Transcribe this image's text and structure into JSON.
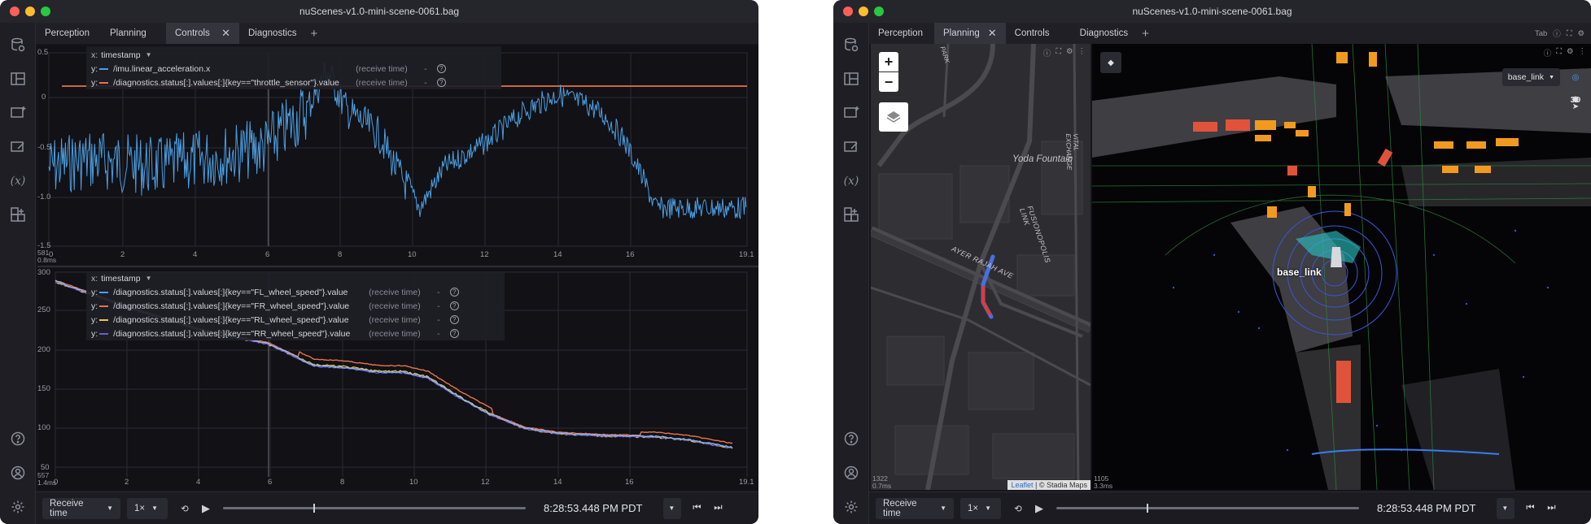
{
  "left_window": {
    "title": "nuScenes-v1.0-mini-scene-0061.bag",
    "tabs": [
      {
        "label": "Perception",
        "active": false
      },
      {
        "label": "Planning",
        "active": false
      },
      {
        "label": "Controls",
        "active": true
      },
      {
        "label": "Diagnostics",
        "active": false
      }
    ],
    "top_plot": {
      "x_axis_label": "timestamp",
      "series": [
        {
          "prefix": "y:",
          "path": "/imu.linear_acceleration.x",
          "timing": "(receive time)",
          "dash": "-",
          "color": "#4c9ee0"
        },
        {
          "prefix": "y:",
          "path": "/diagnostics.status[:].values[:]{key==\"throttle_sensor\"}.value",
          "timing": "(receive time)",
          "dash": "-",
          "color": "#e8734a"
        }
      ],
      "y_ticks": [
        "0.5",
        "0",
        "-0.5",
        "-1.0",
        "-1.5"
      ],
      "x_ticks": [
        "0",
        "2",
        "4",
        "6",
        "8",
        "10",
        "12",
        "14",
        "16",
        "19.1"
      ],
      "corner_labels": [
        "581",
        "0.8ms"
      ]
    },
    "bottom_plot": {
      "x_axis_label": "timestamp",
      "series": [
        {
          "prefix": "y:",
          "path": "/diagnostics.status[:].values[:]{key==\"FL_wheel_speed\"}.value",
          "timing": "(receive time)",
          "dash": "-",
          "color": "#4c9ee0"
        },
        {
          "prefix": "y:",
          "path": "/diagnostics.status[:].values[:]{key==\"FR_wheel_speed\"}.value",
          "timing": "(receive time)",
          "dash": "-",
          "color": "#e8734a"
        },
        {
          "prefix": "y:",
          "path": "/diagnostics.status[:].values[:]{key==\"RL_wheel_speed\"}.value",
          "timing": "(receive time)",
          "dash": "-",
          "color": "#e6c84a"
        },
        {
          "prefix": "y:",
          "path": "/diagnostics.status[:].values[:]{key==\"RR_wheel_speed\"}.value",
          "timing": "(receive time)",
          "dash": "-",
          "color": "#6a5cd8"
        }
      ],
      "y_ticks": [
        "300",
        "250",
        "200",
        "150",
        "100",
        "50"
      ],
      "x_ticks": [
        "0",
        "2",
        "4",
        "6",
        "8",
        "10",
        "12",
        "14",
        "16",
        "19.1"
      ],
      "corner_labels": [
        "557",
        "1.4ms"
      ]
    },
    "playback": {
      "mode": "Receive time",
      "speed": "1×",
      "time": "8:28:53.448 PM PDT",
      "progress": 0.3
    }
  },
  "right_window": {
    "title": "nuScenes-v1.0-mini-scene-0061.bag",
    "tab_hint": "Tab",
    "tabs": [
      {
        "label": "Perception",
        "active": false
      },
      {
        "label": "Planning",
        "active": true
      },
      {
        "label": "Controls",
        "active": false
      },
      {
        "label": "Diagnostics",
        "active": false
      }
    ],
    "map": {
      "zoom_in": "+",
      "zoom_out": "−",
      "street_labels": [
        "Yoda Fountain",
        "FUSIONOPOLIS LINK",
        "AYER RAJAH AVE",
        "PARK",
        "VITAL EXCHANGE"
      ],
      "attribution_leaflet": "Leaflet",
      "attribution_rest": " | © Stadia Maps",
      "corner_labels": [
        "1322",
        "0.7ms"
      ]
    },
    "scene3d": {
      "frame_select": "base_link",
      "frame_label": "base_link",
      "view_mode": "3D",
      "corner_labels": [
        "1105",
        "3.3ms"
      ]
    },
    "playback": {
      "mode": "Receive time",
      "speed": "1×",
      "time": "8:28:53.448 PM PDT",
      "progress": 0.3
    }
  }
}
